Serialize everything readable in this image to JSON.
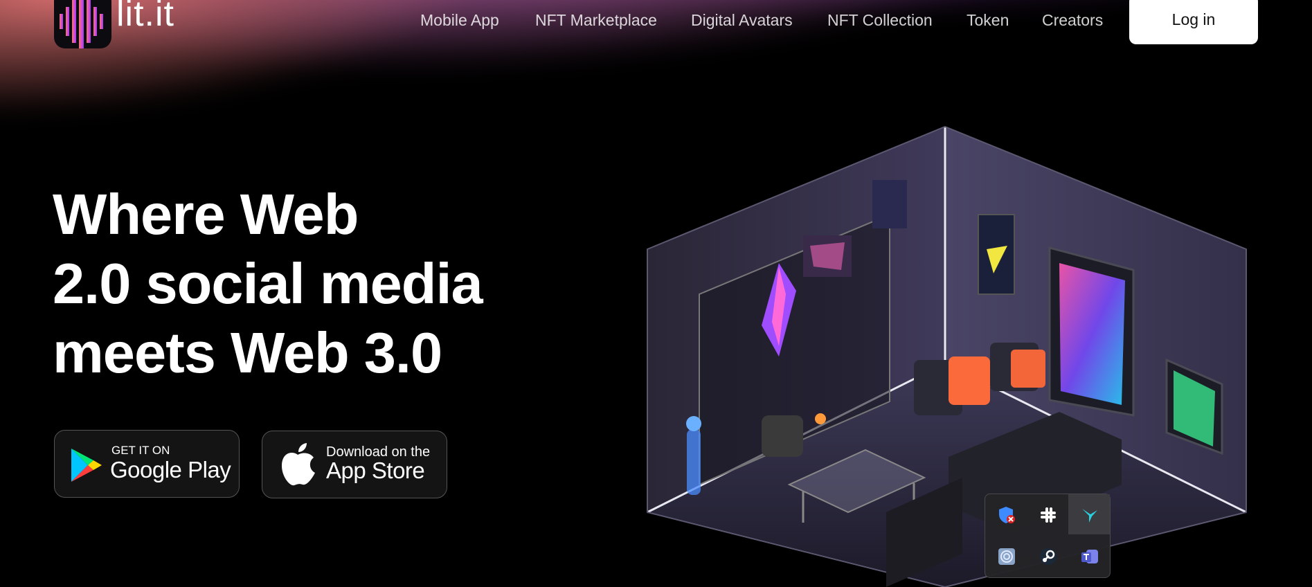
{
  "header": {
    "brand": "lit.it",
    "nav": [
      {
        "id": "mobile-app",
        "label": "Mobile App"
      },
      {
        "id": "nft-marketplace",
        "label": "NFT Marketplace"
      },
      {
        "id": "digital-avatars",
        "label": "Digital Avatars"
      },
      {
        "id": "nft-collection",
        "label": "NFT Collection"
      },
      {
        "id": "token",
        "label": "Token"
      },
      {
        "id": "creators",
        "label": "Creators"
      }
    ],
    "login_label": "Log in"
  },
  "hero": {
    "title_lines": [
      "Where Web",
      "2.0 social media",
      "meets Web 3.0"
    ]
  },
  "stores": {
    "google": {
      "small": "GET IT ON",
      "big": "Google Play",
      "icon": "google-play-icon"
    },
    "apple": {
      "small": "Download on the",
      "big": "App Store",
      "icon": "apple-icon"
    }
  },
  "tray": {
    "icons": [
      "windows-security-icon",
      "slack-icon",
      "hummingbird-icon",
      "fingerprint-icon",
      "steam-icon",
      "teams-icon"
    ]
  },
  "colors": {
    "glow_left": "#ec7878",
    "glow_mid": "#cd6ebe",
    "glow_right": "#9646c8",
    "login_bg": "#ffffff"
  }
}
